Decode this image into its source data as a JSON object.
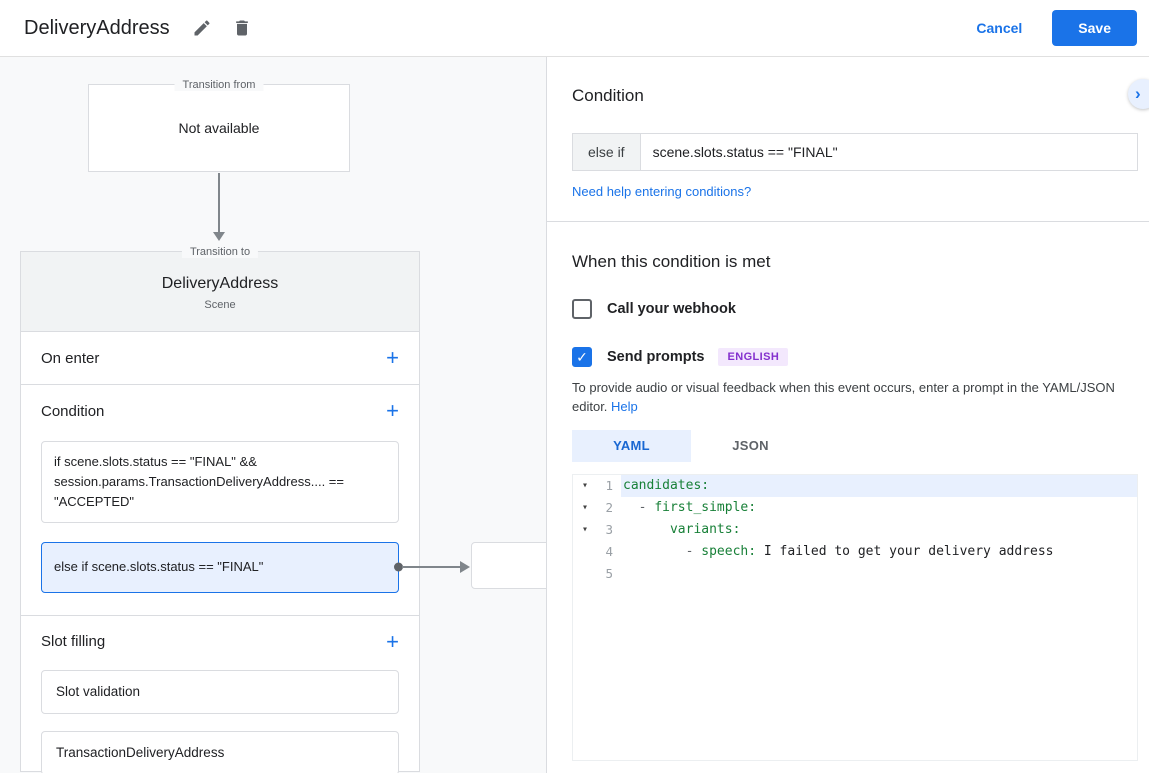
{
  "header": {
    "title": "DeliveryAddress",
    "cancel_label": "Cancel",
    "save_label": "Save"
  },
  "icons": {
    "plus": "+",
    "fold_arrow": "▾",
    "chevron_right": "›",
    "check": "✓"
  },
  "diagram": {
    "transition_from": {
      "label": "Transition from",
      "content": "Not available"
    },
    "transition_to_label": "Transition to",
    "scene": {
      "name": "DeliveryAddress",
      "type": "Scene"
    },
    "on_enter_label": "On enter",
    "condition_label": "Condition",
    "slot_filling_label": "Slot filling",
    "conditions": [
      {
        "text": "if scene.slots.status == \"FINAL\" && session.params.TransactionDeliveryAddress.... == \"ACCEPTED\"",
        "selected": false
      },
      {
        "text": "else if scene.slots.status == \"FINAL\"",
        "selected": true
      }
    ],
    "slots": [
      "Slot validation",
      "TransactionDeliveryAddress"
    ]
  },
  "panel": {
    "title": "Condition",
    "condition_prefix": "else if",
    "condition_value": "scene.slots.status == \"FINAL\"",
    "conditions_help_link": "Need help entering conditions?",
    "when_met_heading": "When this condition is met",
    "webhook_label": "Call your webhook",
    "webhook_checked": false,
    "send_prompts_label": "Send prompts",
    "send_prompts_checked": true,
    "language_badge": "ENGLISH",
    "description": "To provide audio or visual feedback when this event occurs, enter a prompt in the YAML/JSON editor.",
    "help_link": "Help",
    "tabs": [
      {
        "label": "YAML",
        "active": true
      },
      {
        "label": "JSON",
        "active": false
      }
    ],
    "editor": {
      "lines": [
        {
          "number": "1",
          "foldable": true,
          "highlighted": true,
          "parts": [
            {
              "text": "candidates:",
              "type": "key"
            }
          ]
        },
        {
          "number": "2",
          "foldable": true,
          "highlighted": false,
          "parts": [
            {
              "text": "  - ",
              "type": "punct"
            },
            {
              "text": "first_simple:",
              "type": "key"
            }
          ]
        },
        {
          "number": "3",
          "foldable": true,
          "highlighted": false,
          "parts": [
            {
              "text": "      ",
              "type": "punct"
            },
            {
              "text": "variants:",
              "type": "key"
            }
          ]
        },
        {
          "number": "4",
          "foldable": false,
          "highlighted": false,
          "parts": [
            {
              "text": "        - ",
              "type": "punct"
            },
            {
              "text": "speech:",
              "type": "key"
            },
            {
              "text": " I failed to get your delivery address",
              "type": "value"
            }
          ]
        },
        {
          "number": "5",
          "foldable": false,
          "highlighted": false,
          "parts": []
        }
      ]
    }
  },
  "colors": {
    "accent": "#1a73e8",
    "selected_condition_bg": "#e8f0fe",
    "scene_header_bg": "#f1f3f4",
    "badge_bg": "#f3e8fd",
    "badge_text": "#8430ce",
    "yaml_key": "#188038"
  }
}
